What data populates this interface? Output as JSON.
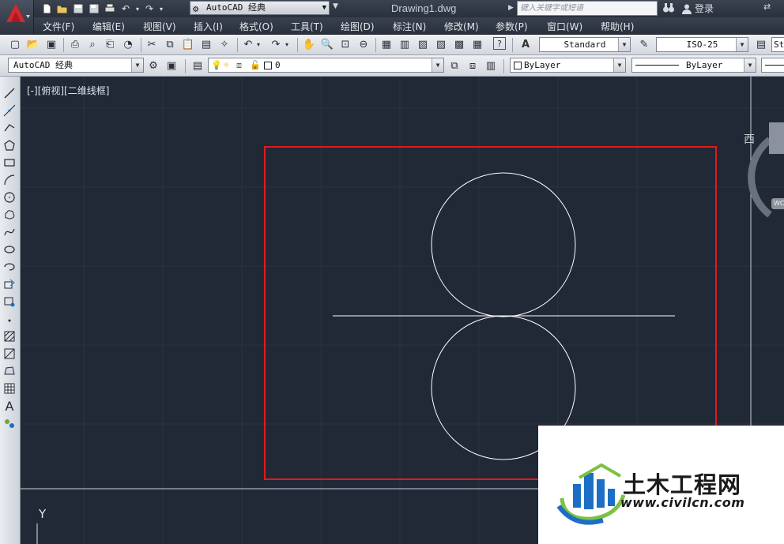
{
  "app": {
    "document_title": "Drawing1.dwg",
    "workspace": "AutoCAD 经典",
    "search_placeholder": "键入关键字或短语",
    "login_label": "登录"
  },
  "menu": [
    "文件(F)",
    "编辑(E)",
    "视图(V)",
    "插入(I)",
    "格式(O)",
    "工具(T)",
    "绘图(D)",
    "标注(N)",
    "修改(M)",
    "参数(P)",
    "窗口(W)",
    "帮助(H)"
  ],
  "toolbar": {
    "text_style": "Standard",
    "dim_style": "ISO-25",
    "table_style_partial": "St",
    "workspace_combo": "AutoCAD 经典",
    "layer": "0",
    "color": "ByLayer",
    "linetype": "ByLayer"
  },
  "viewport": {
    "label": "[-][俯视][二维线框]",
    "viewcube_west": "西",
    "wcs_badge": "WC",
    "ucs_y": "Y"
  },
  "watermark": {
    "title": "土木工程网",
    "url": "www.civilcn.com"
  },
  "colors": {
    "canvas_bg": "#212836",
    "highlight_box": "#e11a1a",
    "geometry": "#ffffff",
    "logo_blue": "#1c6fc4",
    "logo_green": "#7cc142"
  }
}
